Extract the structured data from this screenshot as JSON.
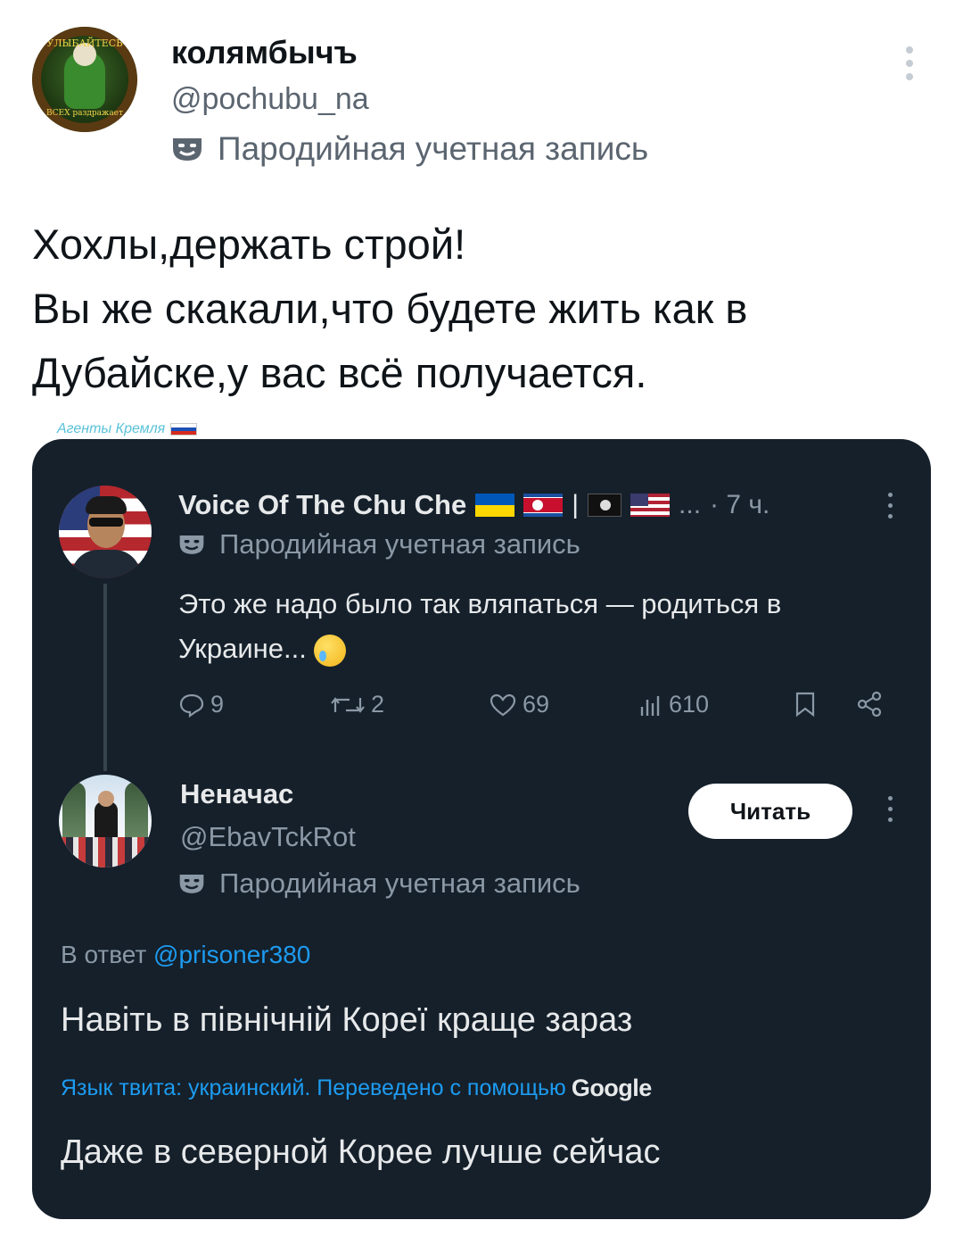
{
  "outer_tweet": {
    "avatar_text_top": "УЛЫБАЙТЕСЬ",
    "avatar_text_bottom": "ВСЕХ раздражает",
    "display_name": "колямбычъ",
    "handle": "@pochubu_na",
    "parody_label": "Пародийная учетная запись",
    "text_lines": [
      "Хохлы,держать строй!",
      "Вы же скакали,что будете жить как в",
      "Дубайске,у вас всё получается."
    ]
  },
  "watermark": {
    "text": "Агенты Кремля"
  },
  "quoted_thread": {
    "tweet1": {
      "display_name": "Voice Of The Chu Che",
      "separator": "|",
      "ellipsis": "...",
      "time": "· 7 ч.",
      "parody_label": "Пародийная учетная запись",
      "text": "Это же надо было так вляпаться — родиться в Украине...",
      "actions": {
        "replies": "9",
        "reposts": "2",
        "likes": "69",
        "views": "610"
      }
    },
    "tweet2": {
      "display_name": "Неначас",
      "handle": "@EbavTckRot",
      "parody_label": "Пародийная учетная запись",
      "follow_label": "Читать",
      "reply_prefix": "В ответ",
      "reply_mention": "@prisoner380",
      "text": "Навіть в північній Кореї краще зараз",
      "translation_note": "Язык твита: украинский. Переведено с помощью",
      "translation_provider": "Google",
      "translation": "Даже в северной Корее лучше сейчас"
    }
  },
  "colors": {
    "card_bg": "#15202b",
    "accent_blue": "#1d9bf0",
    "muted_text_dark": "#8b98a5",
    "muted_text_light": "#5b6570"
  }
}
